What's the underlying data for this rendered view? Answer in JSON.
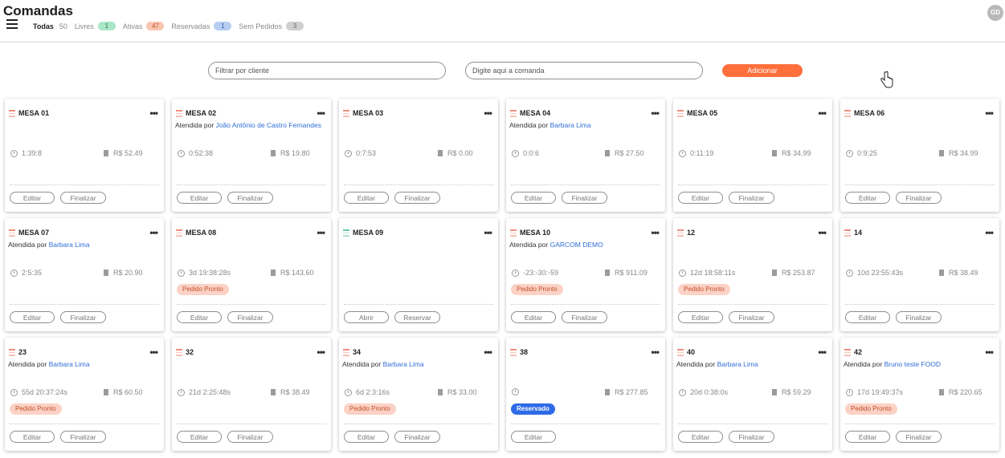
{
  "header": {
    "title": "Comandas",
    "avatar_initials": "GD",
    "filters": [
      {
        "label": "Todas",
        "count": "50",
        "badge": ""
      },
      {
        "label": "Livres",
        "count": "",
        "badge": "1"
      },
      {
        "label": "Ativas",
        "count": "",
        "badge": "47"
      },
      {
        "label": "Reservadas",
        "count": "",
        "badge": "1"
      },
      {
        "label": "Sem Pedidos",
        "count": "",
        "badge": "3"
      }
    ]
  },
  "toolbar": {
    "client_filter_placeholder": "Filtrar por cliente",
    "order_input_placeholder": "Digite aqui a comanda",
    "add_label": "Adicionar"
  },
  "labels": {
    "attended_by": "Atendida por ",
    "edit": "Editar",
    "finish": "Finalizar",
    "open": "Abrir",
    "reserve": "Reservar",
    "more": "•••"
  },
  "colors": {
    "accent": "#ff6f3c",
    "link": "#2f6ed6",
    "ready_tag": "#fbd2c5",
    "reserved_tag": "#2e6be6"
  },
  "cards": [
    {
      "name": "MESA 01",
      "waiter": "",
      "time": "1:39:8",
      "price": "R$ 52.49",
      "tag": "",
      "btn1": "Editar",
      "btn2": "Finalizar",
      "icon": "table-icon-red"
    },
    {
      "name": "MESA 02",
      "waiter": "João Antônio de Castro Fernandes",
      "time": "0:52:38",
      "price": "R$ 19.80",
      "tag": "",
      "btn1": "Editar",
      "btn2": "Finalizar",
      "icon": "table-icon-red"
    },
    {
      "name": "MESA 03",
      "waiter": "",
      "time": "0:7:53",
      "price": "R$ 0.00",
      "tag": "",
      "btn1": "Editar",
      "btn2": "Finalizar",
      "icon": "table-icon-red"
    },
    {
      "name": "MESA 04",
      "waiter": "Barbara Lima",
      "time": "0:0:6",
      "price": "R$ 27.50",
      "tag": "",
      "btn1": "Editar",
      "btn2": "Finalizar",
      "icon": "table-icon-red"
    },
    {
      "name": "MESA 05",
      "waiter": "",
      "time": "0:11:19",
      "price": "R$ 34.99",
      "tag": "",
      "btn1": "Editar",
      "btn2": "Finalizar",
      "icon": "table-icon-red"
    },
    {
      "name": "MESA 06",
      "waiter": "",
      "time": "0:9:25",
      "price": "R$ 34.99",
      "tag": "",
      "btn1": "Editar",
      "btn2": "Finalizar",
      "icon": "table-icon-red"
    },
    {
      "name": "MESA 07",
      "waiter": "Barbara Lima",
      "time": "2:5:35",
      "price": "R$ 20.90",
      "tag": "",
      "btn1": "Editar",
      "btn2": "Finalizar",
      "icon": "table-icon-red"
    },
    {
      "name": "MESA 08",
      "waiter": "",
      "time": "3d 19:38:28s",
      "price": "R$ 143.60",
      "tag": "Pedido Pronto",
      "btn1": "Editar",
      "btn2": "Finalizar",
      "icon": "table-icon-red"
    },
    {
      "name": "MESA 09",
      "waiter": "",
      "time": "",
      "price": "",
      "tag": "",
      "btn1": "Abrir",
      "btn2": "Reservar",
      "icon": "table-icon-green"
    },
    {
      "name": "MESA 10",
      "waiter": "GARCOM DEMO",
      "time": "-23:-30:-59",
      "price": "R$ 911.09",
      "tag": "Pedido Pronto",
      "btn1": "Editar",
      "btn2": "Finalizar",
      "icon": "table-icon-red"
    },
    {
      "name": "12",
      "waiter": "",
      "time": "12d 18:58:11s",
      "price": "R$ 253.87",
      "tag": "Pedido Pronto",
      "btn1": "Editar",
      "btn2": "Finalizar",
      "icon": "table-icon-red"
    },
    {
      "name": "14",
      "waiter": "",
      "time": "10d 23:55:43s",
      "price": "R$ 38.49",
      "tag": "",
      "btn1": "Editar",
      "btn2": "Finalizar",
      "icon": "table-icon-red"
    },
    {
      "name": "23",
      "waiter": "Barbara Lima",
      "time": "55d 20:37:24s",
      "price": "R$ 60.50",
      "tag": "Pedido Pronto",
      "btn1": "Editar",
      "btn2": "Finalizar",
      "icon": "table-icon-red"
    },
    {
      "name": "32",
      "waiter": "",
      "time": "21d 2:25:48s",
      "price": "R$ 38.49",
      "tag": "",
      "btn1": "Editar",
      "btn2": "Finalizar",
      "icon": "table-icon-red"
    },
    {
      "name": "34",
      "waiter": "Barbara Lima",
      "time": "6d 2:3:16s",
      "price": "R$ 33.00",
      "tag": "Pedido Pronto",
      "btn1": "Editar",
      "btn2": "Finalizar",
      "icon": "table-icon-red"
    },
    {
      "name": "38",
      "waiter": "",
      "time": "",
      "price": "R$ 277.85",
      "tag": "Reservado",
      "btn1": "Editar",
      "btn2": "",
      "icon": "table-icon-red"
    },
    {
      "name": "40",
      "waiter": "Barbara Lima",
      "time": "20d 0:38:0s",
      "price": "R$ 59.29",
      "tag": "",
      "btn1": "Editar",
      "btn2": "Finalizar",
      "icon": "table-icon-red"
    },
    {
      "name": "42",
      "waiter": "Bruno teste FOOD",
      "time": "17d 19:49:37s",
      "price": "R$ 220.65",
      "tag": "Pedido Pronto",
      "btn1": "Editar",
      "btn2": "Finalizar",
      "icon": "table-icon-red"
    }
  ]
}
